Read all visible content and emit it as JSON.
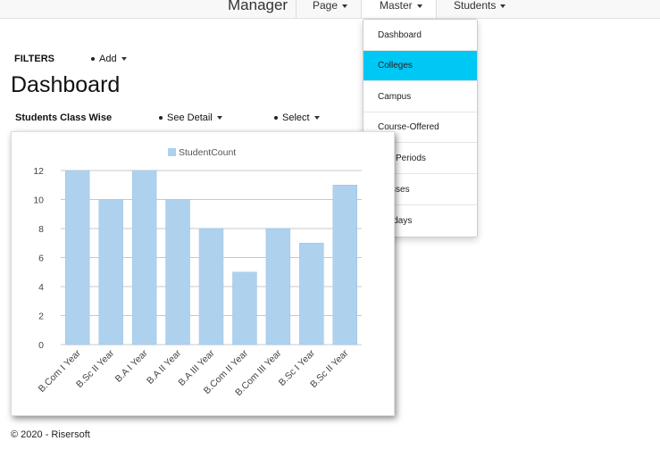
{
  "navbar": {
    "brand": "Manager",
    "items": [
      "Page",
      "Master",
      "Students"
    ]
  },
  "dropdown": {
    "items": [
      "Dashboard",
      "Colleges",
      "Campus",
      "Course-Offered",
      "Pay Periods",
      "Classes",
      "Holidays"
    ],
    "highlighted": "Colleges",
    "highlight_color": "#00c8f5"
  },
  "filters": {
    "label": "FILTERS",
    "add": "Add"
  },
  "page": {
    "title": "Dashboard"
  },
  "section": {
    "title": "Students Class Wise",
    "see_detail": "See Detail",
    "select": "Select"
  },
  "chart_data": {
    "type": "bar",
    "categories": [
      "B.Com I Year",
      "B.Sc II Year",
      "B.A I Year",
      "B.A II Year",
      "B.A III Year",
      "B.Com II Year",
      "B.Com III Year",
      "B.Sc I Year",
      "B.Sc II Year"
    ],
    "series": [
      {
        "name": "StudentCount",
        "values": [
          12,
          10,
          12,
          10,
          8,
          5,
          8,
          7,
          11
        ],
        "color": "#aed1ee"
      }
    ],
    "yticks": [
      0,
      2,
      4,
      6,
      8,
      10,
      12
    ],
    "ylim": [
      0,
      12
    ],
    "legend": "top",
    "grid": true
  },
  "footer": {
    "text": "© 2020 - Risersoft"
  }
}
